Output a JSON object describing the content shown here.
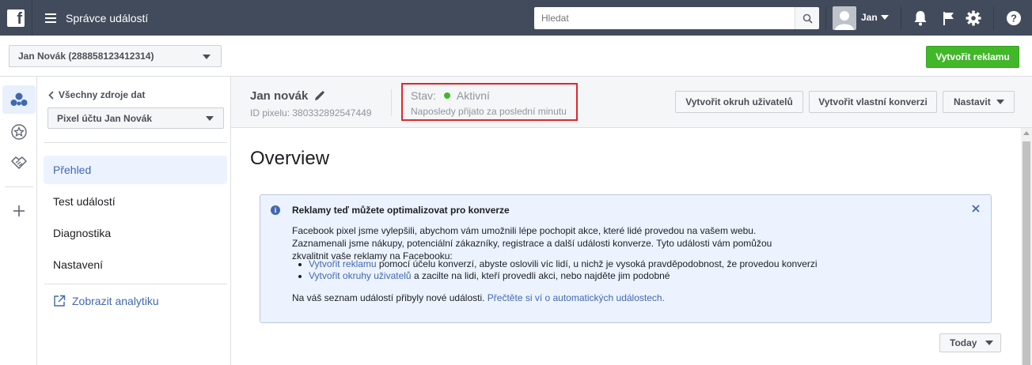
{
  "topbar": {
    "logo_letter": "f",
    "title": "Správce událostí",
    "search_placeholder": "Hledat",
    "user_name": "Jan"
  },
  "account": {
    "selected": "Jan Novák (288858123412314)",
    "create_ad_label": "Vytvořit reklamu"
  },
  "sidebar": {
    "back_label": "Všechny zdroje dat",
    "pixel_selected": "Pixel účtu Jan Novák",
    "items": [
      {
        "label": "Přehled"
      },
      {
        "label": "Test událostí"
      },
      {
        "label": "Diagnostika"
      },
      {
        "label": "Nastavení"
      }
    ],
    "analytics_label": "Zobrazit analytiku"
  },
  "header": {
    "pixel_name": "Jan novák",
    "pixel_id": "ID pixelu: 380332892547449",
    "status_label": "Stav:",
    "status_value": "Aktivní",
    "status_sub": "Naposledy přijato za poslední minutu",
    "btn_audience": "Vytvořit okruh uživatelů",
    "btn_conversion": "Vytvořit vlastní konverzi",
    "btn_settings": "Nastavit"
  },
  "main": {
    "title": "Overview",
    "info": {
      "title": "Reklamy teď můžete optimalizovat pro konverze",
      "para": "Facebook pixel jsme vylepšili, abychom vám umožnili lépe pochopit akce, které lidé provedou na vašem webu. Zaznamenali jsme nákupy, potenciální zákazníky, registrace a další události konverze. Tyto události vám pomůžou zkvalitnit vaše reklamy na Facebooku:",
      "bullet1_link": "Vytvořit reklamu",
      "bullet1_text": " pomocí účelu konverzí, abyste oslovili víc lidí, u nichž je vysoká pravděpodobnost, že provedou konverzi",
      "bullet2_link": "Vytvořit okruhy uživatelů",
      "bullet2_text": " a zacilte na lidi, kteří provedli akci, nebo najděte jim podobné",
      "foot_text": "Na váš seznam událostí přibyly nové události. ",
      "foot_link": "Přečtěte si ví o automatických událostech."
    },
    "date_range": "Today"
  },
  "colors": {
    "topbar": "#424b5b",
    "accent": "#4267b2",
    "create_button": "#42b72a",
    "status_dot": "#42b72a",
    "highlight_border": "#e0262e"
  }
}
